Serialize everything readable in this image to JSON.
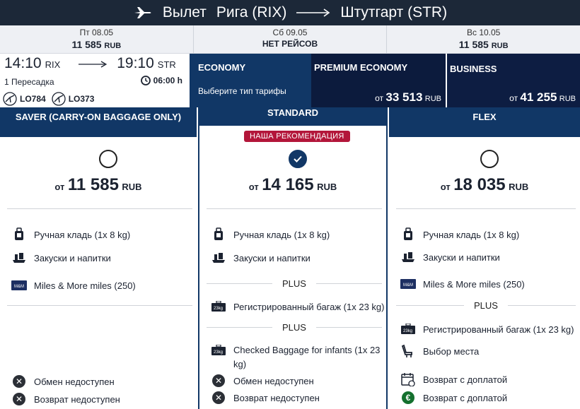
{
  "header": {
    "label": "Вылет",
    "origin": "Рига (RIX)",
    "destination": "Штутгарт (STR)"
  },
  "dates": [
    {
      "day": "Пт 08.05",
      "price": "11 585",
      "currency": "RUB"
    },
    {
      "day": "Сб 09.05",
      "price": "НЕТ РЕЙСОВ",
      "currency": ""
    },
    {
      "day": "Вс 10.05",
      "price": "11 585",
      "currency": "RUB"
    }
  ],
  "flight": {
    "dep_time": "14:10",
    "dep_code": "RIX",
    "arr_time": "19:10",
    "arr_code": "STR",
    "stops": "1 Пересадка",
    "duration": "06:00 h",
    "flight_numbers": [
      "LO784",
      "LO373"
    ]
  },
  "cabins": {
    "economy": {
      "name": "ECONOMY",
      "subtitle": "Выберите тип тарифы"
    },
    "premium": {
      "name": "PREMIUM ECONOMY",
      "price_prefix": "от",
      "price": "33 513",
      "currency": "RUB"
    },
    "business": {
      "name": "BUSINESS",
      "price_prefix": "от",
      "price": "41 255",
      "currency": "RUB"
    }
  },
  "fares": {
    "recommendation": "НАША РЕКОМЕНДАЦИЯ",
    "plus": "PLUS",
    "price_prefix": "от",
    "currency": "RUB",
    "saver": {
      "name": "SAVER (CARRY-ON BAGGAGE ONLY)",
      "price": "11 585",
      "features": [
        "Ручная кладь (1x 8 kg)",
        "Закуски и напитки",
        "Miles & More miles (250)"
      ],
      "restrictions": [
        "Обмен недоступен",
        "Возврат недоступен"
      ]
    },
    "standard": {
      "name": "STANDARD",
      "price": "14 165",
      "features": [
        "Ручная кладь (1x 8 kg)",
        "Закуски и напитки",
        "Регистрированный багаж (1x 23 kg)",
        "Checked Baggage for infants (1x 23 kg)"
      ],
      "restrictions": [
        "Обмен недоступен",
        "Возврат недоступен"
      ]
    },
    "flex": {
      "name": "FLEX",
      "price": "18 035",
      "features": [
        "Ручная кладь (1x 8 kg)",
        "Закуски и напитки",
        "Miles & More miles (250)",
        "Регистрированный багаж (1x 23 kg)",
        "Выбор места",
        "Возврат с доплатой",
        "Возврат с доплатой"
      ]
    }
  },
  "colors": {
    "navy": "#113766",
    "dark_navy": "#0c1b3d",
    "header_bg": "#1c2838",
    "recommendation": "#b3163a"
  }
}
